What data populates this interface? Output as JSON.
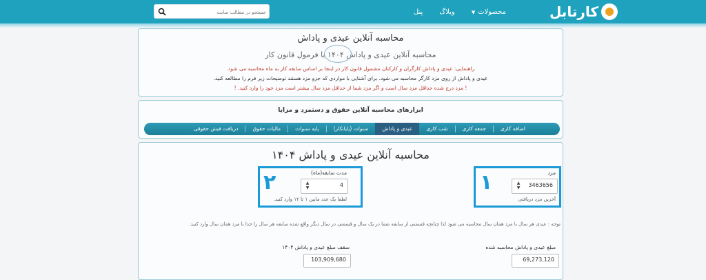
{
  "header": {
    "logo_text": "کارتابل",
    "nav": {
      "products": "محصولات",
      "blog": "وبلاگ",
      "panel": "پنل"
    },
    "search_placeholder": "جستجو در مطالب سایت"
  },
  "intro": {
    "title": "محاسبه آنلاین عیدی و پاداش",
    "subtitle": "محاسبه آنلاین عیدی و پاداش ۱۴۰۴ با فرمول قانون کار",
    "line1": "راهنمایی: عیدی و پاداش کارگران و کارکنان مشمول قانون کار در اینجا بر اساس سابقه کار به ماه محاسبه می شود.",
    "line2": "عیدی و پاداش از روی مزد کارگر محاسبه می شود. برای آشنایی با مواردی که جزو مزد هستند توضیحات زیر فرم را مطالعه کنید.",
    "line3": "! مزد درج شده حداقل مزد سال است و اگر مزد شما از حداقل مزد سال بیشتر است مزد خود را وارد کنید. !"
  },
  "tools": {
    "title": "ابزارهای محاسبه آنلاین حقوق و دستمزد و مزایا",
    "tabs": [
      "اضافه کاری",
      "جمعه کاری",
      "شب کاری",
      "عیدی و پاداش",
      "سنوات (پایانکار)",
      "پایه سنوات",
      "مالیات حقوق",
      "دریافت فیش حقوقی"
    ],
    "active_tab": 3
  },
  "calculator": {
    "title": "محاسبه آنلاین عیدی و پاداش ۱۴۰۴",
    "wage": {
      "label": "مزد",
      "value": "3463656",
      "help": "آخرین مزد دریافتی",
      "annotation": "۱"
    },
    "tenure": {
      "label": "مدت سابقه(ماه)",
      "value": "4",
      "help": "لطفا یک عدد مابین ۱ تا ۱۲ وارد کنید.",
      "annotation": "۲"
    },
    "note": "توجه : عیدی هر سال با مزد همان سال محاسبه می شود لذا چنانچه قسمتی از سابقه شما در یک سال و قسمتی در سال دیگر واقع شده سابقه هر سال را جدا با مزد همان سال وارد کنید.",
    "result": {
      "label": "مبلغ عیدی و پاداش محاسبه شده",
      "value": "69,273,120"
    },
    "cap": {
      "label": "سقف مبلغ عیدی و پاداش ۱۴۰۴",
      "value": "103,909,680"
    }
  },
  "colors": {
    "header": "#1ea2be",
    "annotation": "#1a9ad6",
    "active_tab": "#2b5f82"
  }
}
